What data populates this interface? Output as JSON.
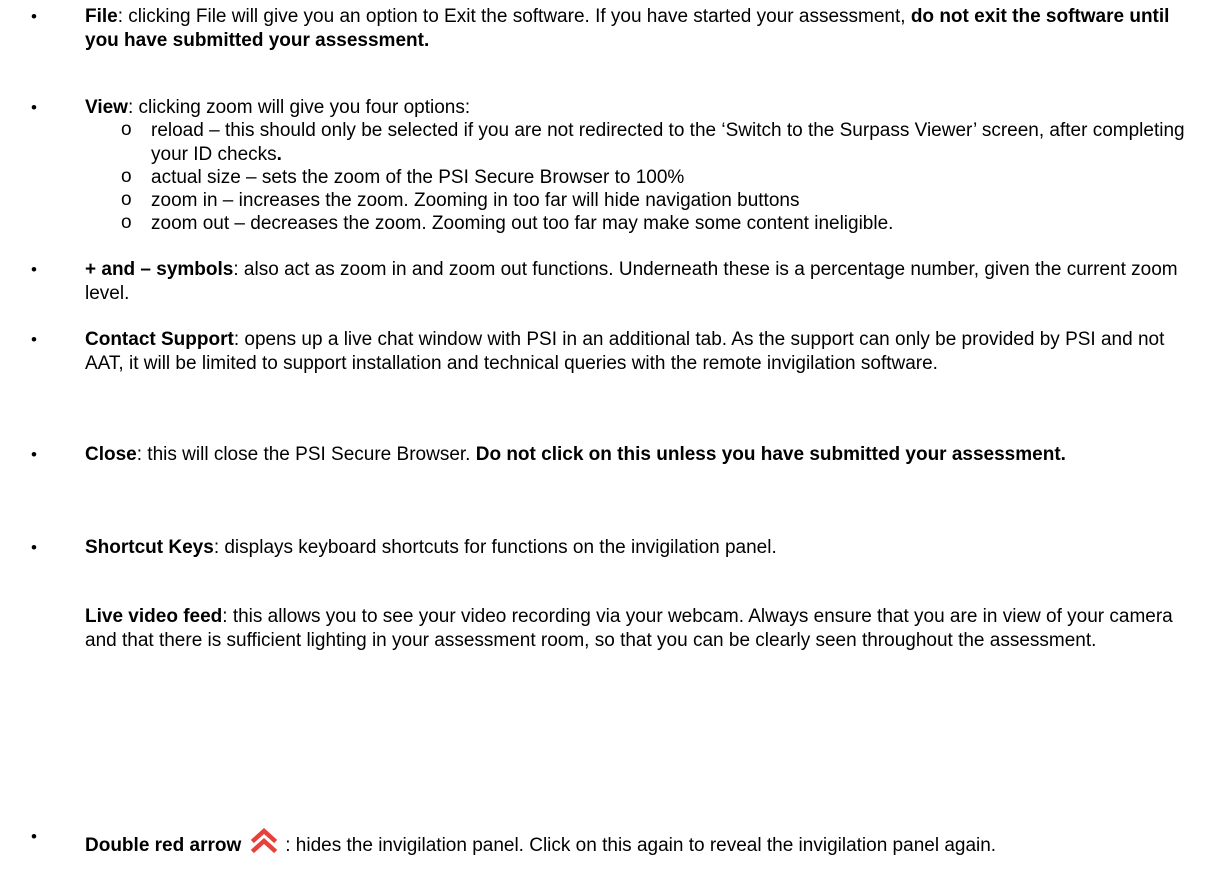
{
  "items": [
    {
      "term": "File",
      "text": ": clicking File will give you an option to Exit the software. If you have started your assessment, ",
      "bold_tail": "do not exit the software until you have submitted your assessment."
    },
    {
      "term": "View",
      "text": ": clicking zoom will give you four options:"
    },
    {
      "term": "+ and – symbols",
      "text": ": also act as zoom in and zoom out functions. Underneath these is a percentage number, given the current zoom level."
    },
    {
      "term": "Contact Support",
      "text": ": opens up a live chat window with PSI in an additional tab. As the support can only be provided by PSI and not AAT, it will be limited to support installation and technical queries with the remote invigilation software."
    },
    {
      "term": "Close",
      "text": ": this will close the PSI Secure Browser. ",
      "bold_tail": "Do not click on this unless you have submitted your assessment."
    },
    {
      "term": "Shortcut Keys",
      "text": ": displays keyboard shortcuts for functions on the invigilation panel."
    },
    {
      "term": "Double red arrow",
      "text": ": hides the invigilation panel. Click on this again to reveal the invigilation panel again."
    }
  ],
  "view_options": [
    {
      "text": "reload – this should only be selected if you are not redirected to the ‘Switch to the Surpass Viewer’ screen, after completing your ID checks",
      "bold_tail": "."
    },
    {
      "text": "actual size – sets the zoom of the PSI Secure Browser to 100%"
    },
    {
      "text": "zoom in – increases the zoom. Zooming in too far will hide navigation buttons"
    },
    {
      "text": "zoom out – decreases the zoom. Zooming out too far may make some content ineligible."
    }
  ],
  "live_video": {
    "term": "Live video feed",
    "text": ": this allows you to see your video recording via your webcam. Always ensure that you are in view of your camera and that there is sufficient lighting in your assessment room, so that you can be clearly seen throughout the assessment."
  },
  "bullet_glyph": "•",
  "sub_glyph": "o",
  "colors": {
    "arrow": "#e8403a"
  },
  "icons": {
    "double_arrow": "double-chevron-up-red"
  }
}
